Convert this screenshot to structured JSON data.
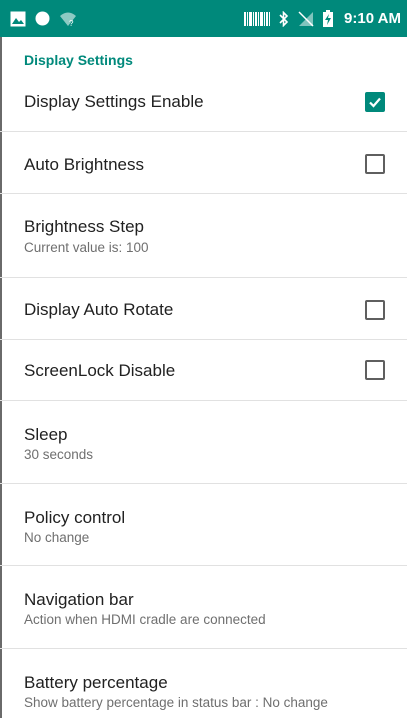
{
  "status_bar": {
    "time": "9:10 AM",
    "left_icons": [
      "image-icon",
      "circle-icon",
      "wifi-question-icon"
    ],
    "right_icons": [
      "barcode-icon",
      "bluetooth-icon",
      "no-signal-icon",
      "battery-charging-icon"
    ]
  },
  "colors": {
    "accent": "#00897b"
  },
  "section_header": "Display Settings",
  "preferences": [
    {
      "title": "Display Settings Enable",
      "checkbox": true,
      "checked": true
    },
    {
      "title": "Auto Brightness",
      "checkbox": true,
      "checked": false
    },
    {
      "title": "Brightness Step",
      "summary": "Current value is: 100"
    },
    {
      "title": "Display Auto Rotate",
      "checkbox": true,
      "checked": false
    },
    {
      "title": "ScreenLock Disable",
      "checkbox": true,
      "checked": false
    },
    {
      "title": "Sleep",
      "summary": "30 seconds"
    },
    {
      "title": "Policy control",
      "summary": "No change"
    },
    {
      "title": "Navigation bar",
      "summary": "Action when HDMI cradle are connected"
    },
    {
      "title": "Battery percentage",
      "summary": "Show battery percentage in status bar : No change"
    }
  ]
}
